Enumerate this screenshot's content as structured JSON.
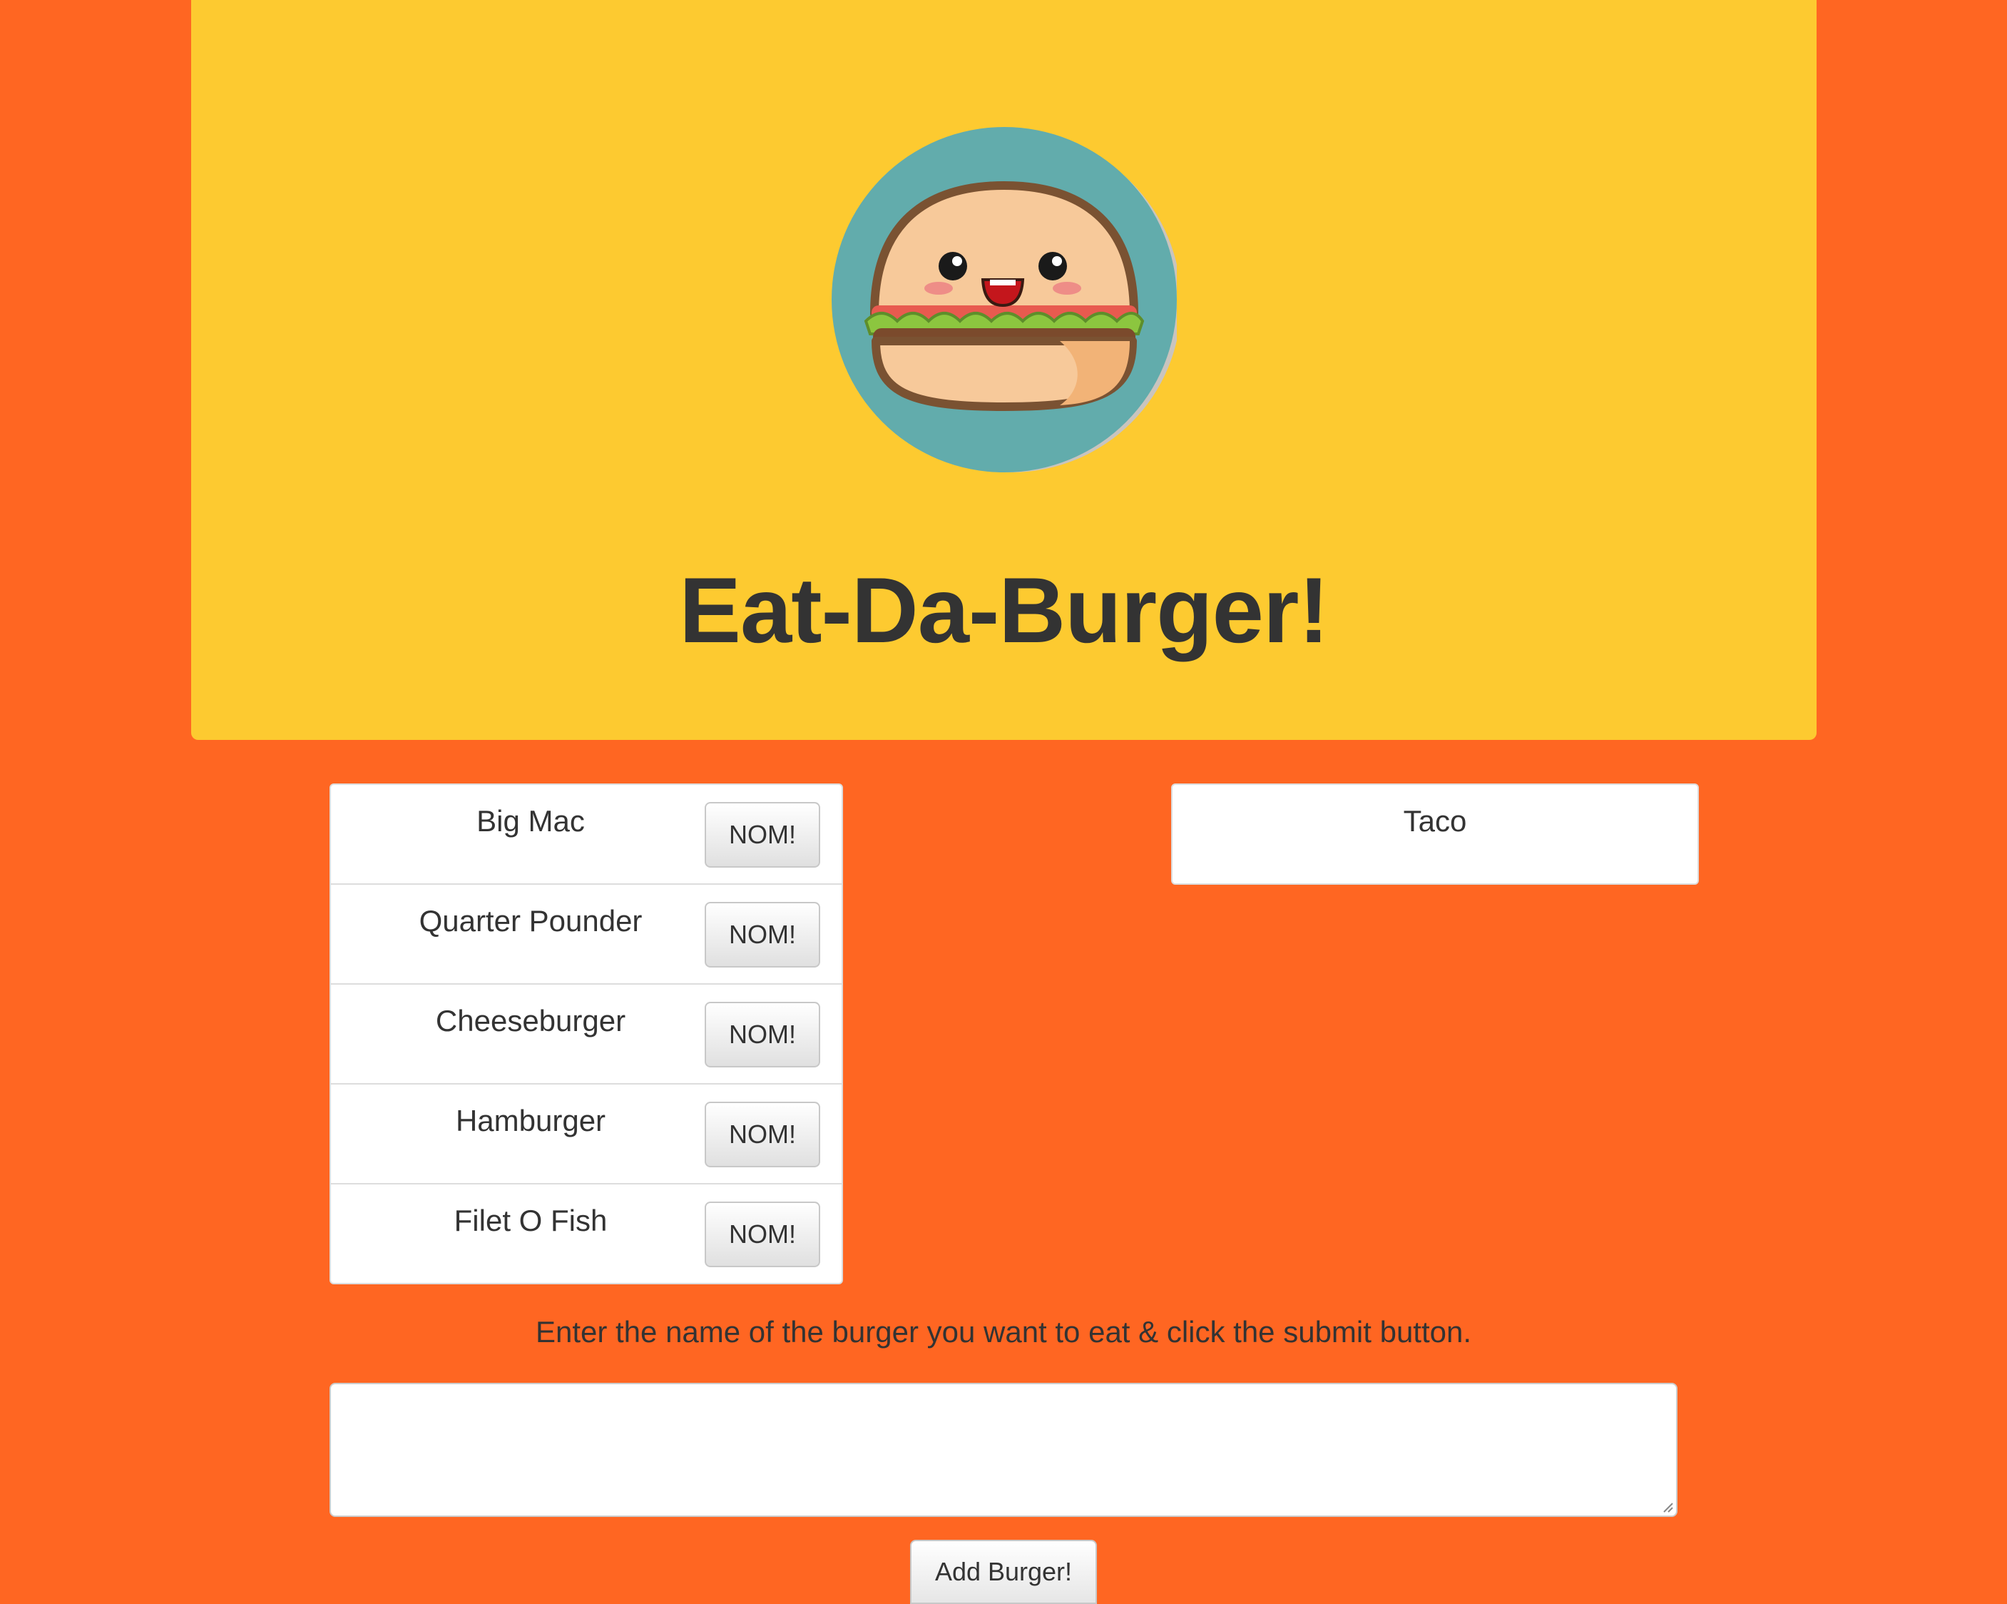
{
  "header": {
    "title": "Eat-Da-Burger!",
    "logo_icon": "burger-mascot-icon",
    "background_color": "#FDCA30"
  },
  "page": {
    "background_color": "#FF6622"
  },
  "burgers_to_eat": [
    {
      "name": "Big Mac",
      "button_label": "NOM!"
    },
    {
      "name": "Quarter Pounder",
      "button_label": "NOM!"
    },
    {
      "name": "Cheeseburger",
      "button_label": "NOM!"
    },
    {
      "name": "Hamburger",
      "button_label": "NOM!"
    },
    {
      "name": "Filet O Fish",
      "button_label": "NOM!"
    }
  ],
  "devoured": [
    {
      "name": "Taco"
    }
  ],
  "form": {
    "instructions": "Enter the name of the burger you want to eat & click the submit button.",
    "input_value": "",
    "submit_label": "Add Burger!"
  }
}
